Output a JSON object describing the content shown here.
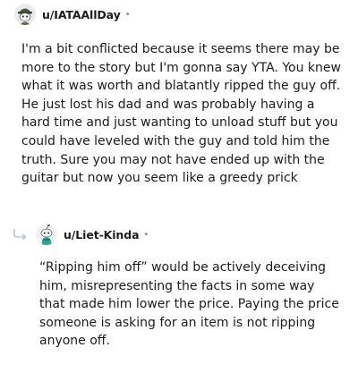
{
  "comment1": {
    "username": "u/IATAAllDay",
    "separator": "•",
    "body": "I'm a bit conflicted because it seems there may be more to the story but I'm gonna say YTA. You knew what it was worth and blatantly ripped the guy off. He just lost his dad and was probably having a hard time and just wanting to unload stuff but you could have leveled with the guy and told him the truth. Sure you may not have ended up with the guitar but now you seem like a greedy prick"
  },
  "comment2": {
    "username": "u/Liet-Kinda",
    "separator": "•",
    "body": "“Ripping him off” would be actively deceiving him, misrepresenting the facts in some way that made him lower the price. Paying the price someone is asking for an item is not ripping anyone off."
  },
  "icons": {
    "avatar1": "snoo-soldier-avatar",
    "avatar2": "snoo-teal-avatar",
    "reply": "reply-arrow-icon"
  },
  "colors": {
    "text": "#1c1c1c",
    "meta": "#8a8a8a",
    "thread_line": "#b8c5d1"
  }
}
